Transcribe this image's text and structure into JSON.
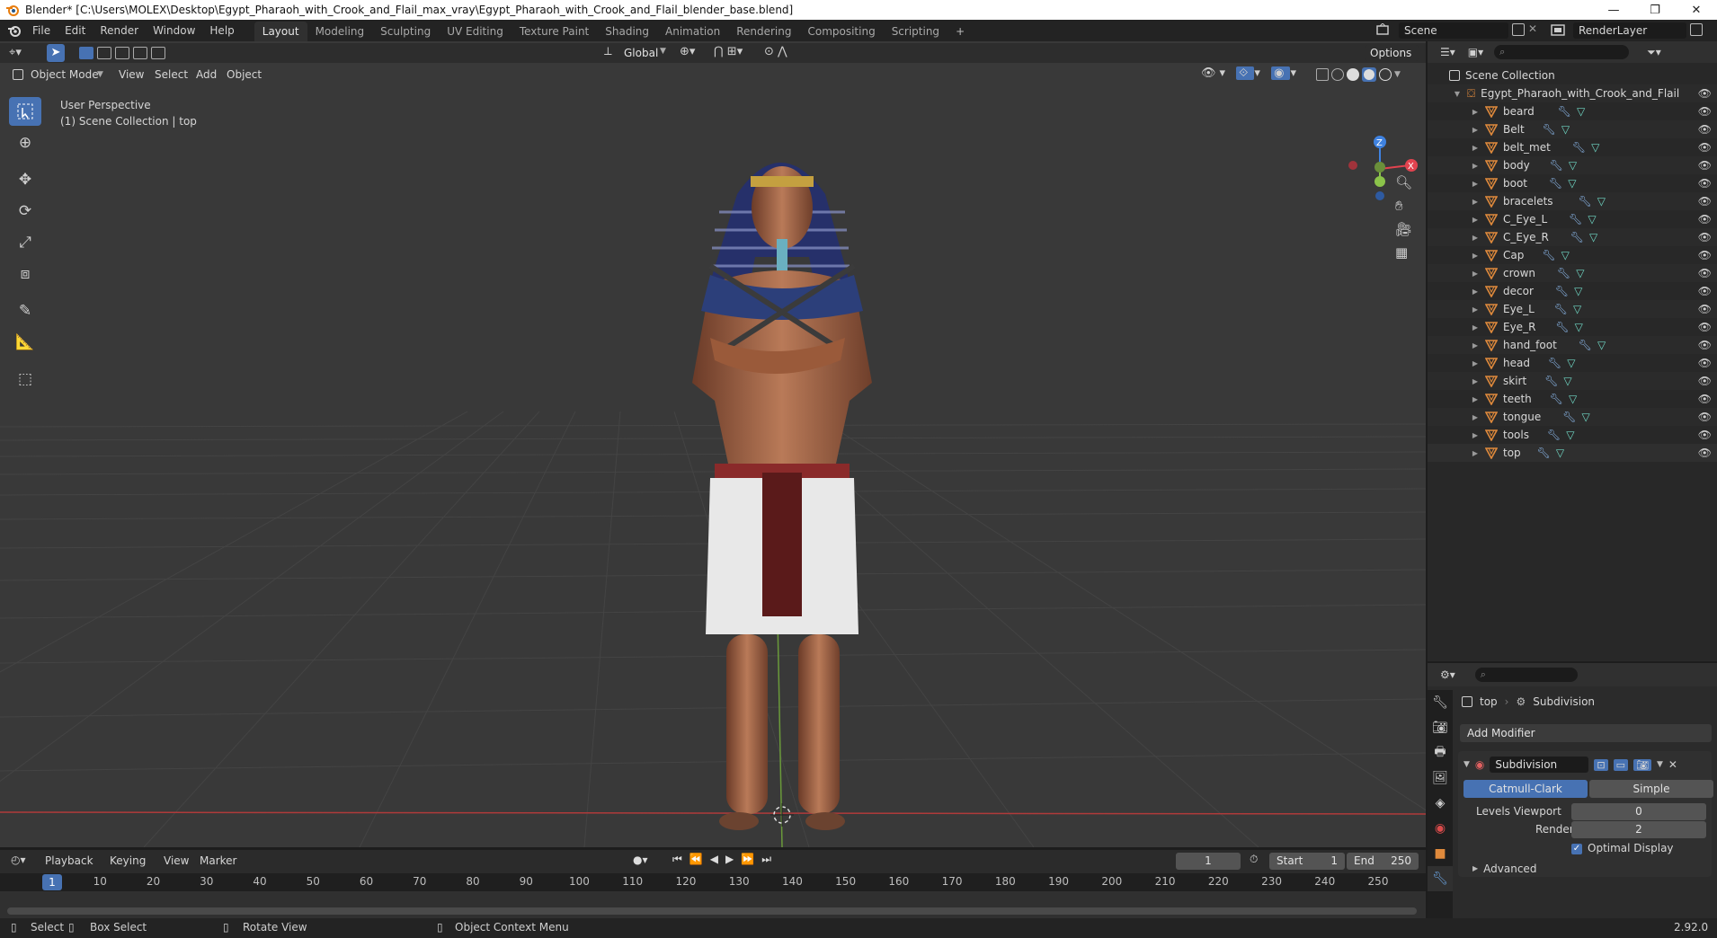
{
  "window": {
    "title": "Blender* [C:\\Users\\MOLEX\\Desktop\\Egypt_Pharaoh_with_Crook_and_Flail_max_vray\\Egypt_Pharaoh_with_Crook_and_Flail_blender_base.blend]",
    "minimize": "—",
    "maximize": "❐",
    "close": "✕"
  },
  "menu": {
    "items": [
      "File",
      "Edit",
      "Render",
      "Window",
      "Help"
    ]
  },
  "workspaces": {
    "tabs": [
      "Layout",
      "Modeling",
      "Sculpting",
      "UV Editing",
      "Texture Paint",
      "Shading",
      "Animation",
      "Rendering",
      "Compositing",
      "Scripting"
    ],
    "active": "Layout",
    "add": "+"
  },
  "scene": {
    "name": "Scene",
    "view_layer": "RenderLayer"
  },
  "viewport": {
    "mode": "Object Mode",
    "menus": [
      "View",
      "Select",
      "Add",
      "Object"
    ],
    "transform_orientation": "Global",
    "options_label": "Options",
    "info_line1": "User Perspective",
    "info_line2": "(1) Scene Collection | top",
    "gizmo": {
      "z": "Z",
      "x": "X",
      "y": "Y"
    }
  },
  "outliner": {
    "root": "Scene Collection",
    "collection": "Egypt_Pharaoh_with_Crook_and_Flail",
    "objects": [
      "beard",
      "Belt",
      "belt_met",
      "body",
      "boot",
      "bracelets",
      "C_Eye_L",
      "C_Eye_R",
      "Cap",
      "crown",
      "decor",
      "Eye_L",
      "Eye_R",
      "hand_foot",
      "head",
      "skirt",
      "teeth",
      "tongue",
      "tools",
      "top"
    ],
    "active_object": "top"
  },
  "properties": {
    "breadcrumb_object": "top",
    "breadcrumb_modifier": "Subdivision",
    "add_modifier": "Add Modifier",
    "modifier_name": "Subdivision",
    "algorithm_options": [
      "Catmull-Clark",
      "Simple"
    ],
    "algorithm_selected": "Catmull-Clark",
    "levels_viewport_label": "Levels Viewport",
    "levels_viewport": "0",
    "render_label": "Render",
    "render": "2",
    "optimal_display": "Optimal Display",
    "advanced": "Advanced"
  },
  "timeline": {
    "menus": [
      "Playback",
      "Keying",
      "View",
      "Marker"
    ],
    "current_frame": "1",
    "start_label": "Start",
    "start": "1",
    "end_label": "End",
    "end": "250",
    "ticks": [
      "1",
      "10",
      "20",
      "30",
      "40",
      "50",
      "60",
      "70",
      "80",
      "90",
      "100",
      "110",
      "120",
      "130",
      "140",
      "150",
      "160",
      "170",
      "180",
      "190",
      "200",
      "210",
      "220",
      "230",
      "240",
      "250"
    ]
  },
  "statusbar": {
    "select": "Select",
    "box_select": "Box Select",
    "rotate_view": "Rotate View",
    "context_menu": "Object Context Menu",
    "version": "2.92.0"
  },
  "colors": {
    "accent": "#4772b3",
    "x_axis": "#e2434f",
    "y_axis": "#8bc34a",
    "z_axis": "#3f82e0",
    "mesh_icon": "#e08a3c",
    "modifier_icon": "#8ab6e8",
    "data_icon": "#6fd6c3"
  }
}
